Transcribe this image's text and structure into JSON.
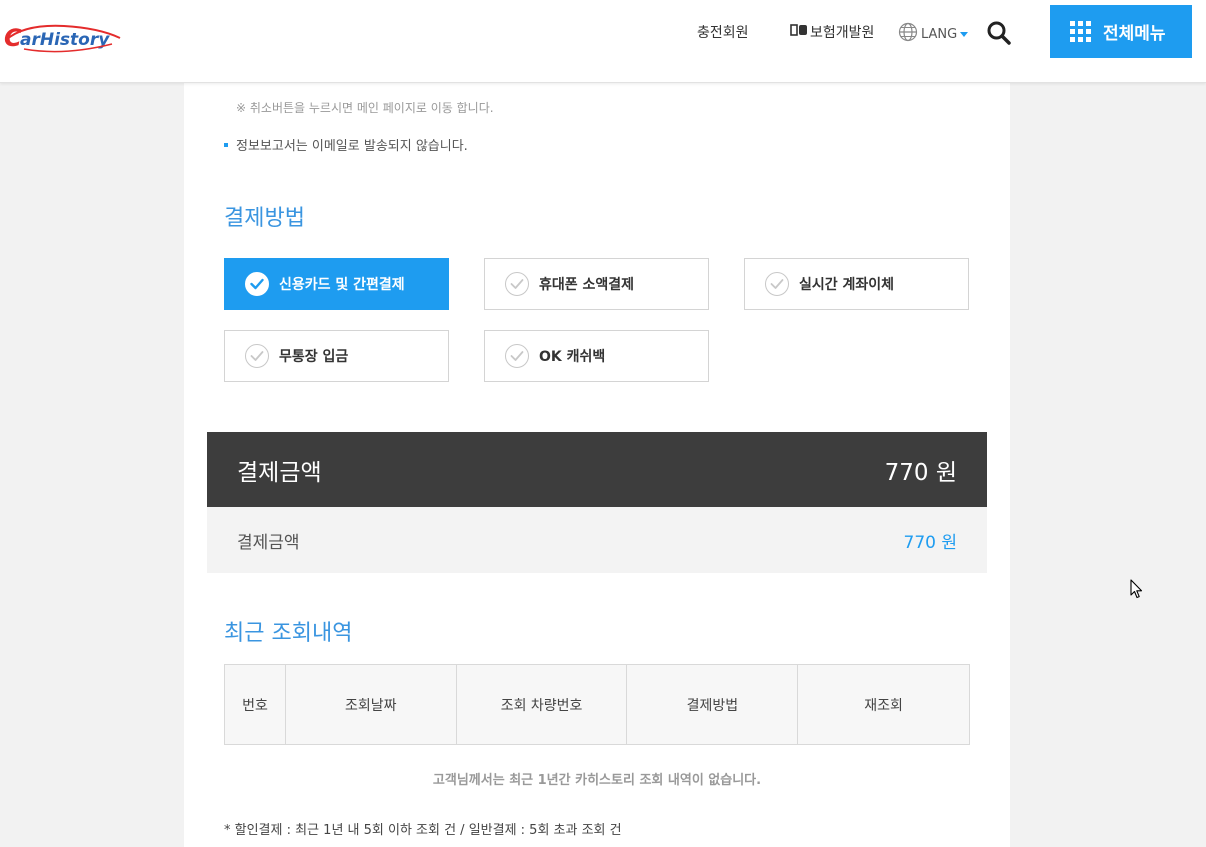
{
  "header": {
    "logo_text": "CarHistory",
    "charge_member": "충전회원",
    "insurance_institute": "보험개발원",
    "lang": "LANG",
    "full_menu": "전체메뉴"
  },
  "notice": {
    "cancel_note": "※ 취소버튼을 누르시면 메인 페이지로 이동 합니다.",
    "email_note": "정보보고서는 이메일로 발송되지 않습니다."
  },
  "payment": {
    "title": "결제방법",
    "options": [
      {
        "label": "신용카드 및 간편결제",
        "selected": true
      },
      {
        "label": "휴대폰 소액결제",
        "selected": false
      },
      {
        "label": "실시간 계좌이체",
        "selected": false
      },
      {
        "label": "무통장 입금",
        "selected": false
      },
      {
        "label": "OK 캐쉬백",
        "selected": false
      }
    ]
  },
  "amount": {
    "dark_label": "결제금액",
    "dark_value": "770 원",
    "light_label": "결제금액",
    "light_value": "770 원"
  },
  "recent": {
    "title": "최근 조회내역",
    "columns": [
      "번호",
      "조회날짜",
      "조회 차량번호",
      "결제방법",
      "재조회"
    ],
    "empty_message": "고객님께서는 최근 1년간 카히스토리 조회 내역이 없습니다.",
    "footnote": "* 할인결제 : 최근 1년 내 5회 이하 조회 건 / 일반결제 : 5회 초과 조회 건"
  },
  "colors": {
    "accent": "#1e9cf0",
    "dark_bar": "#3d3d3d",
    "logo_red": "#e42c2c",
    "logo_blue": "#2a66b5"
  },
  "icons": {
    "search": "search-icon",
    "globe": "globe-icon",
    "grid": "grid-icon",
    "check": "check-circle-icon"
  }
}
